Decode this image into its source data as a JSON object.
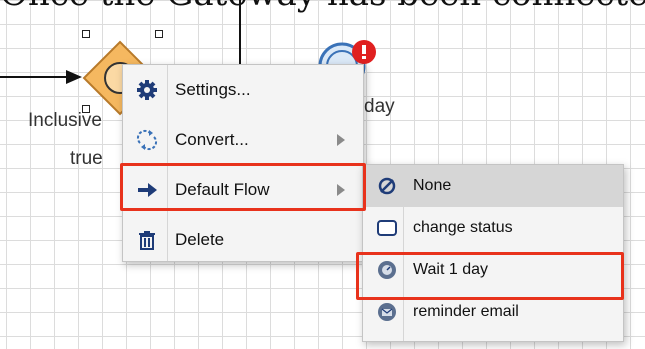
{
  "heading": "Once the Gateway has been connected t",
  "canvas": {
    "gateway_label_line1": "Inclusive",
    "gateway_label_line2": "true",
    "event_label_partial": "day"
  },
  "context_menu": {
    "items": [
      {
        "label": "Settings...",
        "icon": "gear-icon"
      },
      {
        "label": "Convert...",
        "icon": "convert-icon",
        "has_submenu": true
      },
      {
        "label": "Default Flow",
        "icon": "arrow-right-icon",
        "has_submenu": true,
        "highlighted": true
      },
      {
        "label": "Delete",
        "icon": "trash-icon"
      }
    ]
  },
  "submenu": {
    "items": [
      {
        "label": "None",
        "icon": "none-icon",
        "selected": true
      },
      {
        "label": "change status",
        "icon": "task-icon"
      },
      {
        "label": "Wait 1 day",
        "icon": "timer-event-icon",
        "highlighted": true
      },
      {
        "label": "reminder email",
        "icon": "message-event-icon"
      }
    ]
  },
  "colors": {
    "highlight": "#e8321c",
    "gateway_fill": "#f5b860",
    "event_blue": "#3a72b8",
    "badge_red": "#e02020"
  }
}
